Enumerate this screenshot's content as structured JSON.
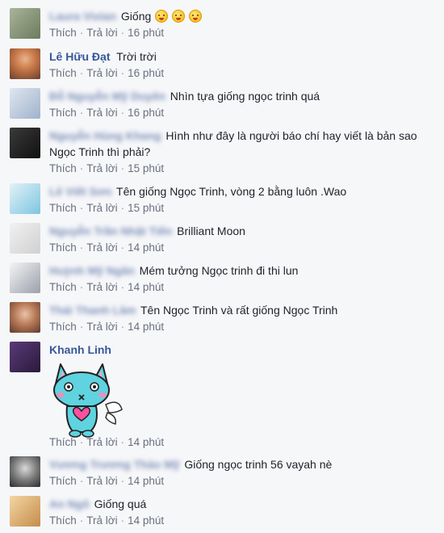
{
  "actions": {
    "like": "Thích",
    "reply": "Trả lời",
    "dot": "·"
  },
  "comments": [
    {
      "name": "Laura Vivian",
      "text": "Giống",
      "time": "16 phút"
    },
    {
      "name": "Lê Hữu Đạt",
      "text": "Trời trời",
      "time": "16 phút"
    },
    {
      "name": "Đỗ Nguyễn Mỹ Duyên",
      "text": "Nhìn tựa giống ngọc trinh quá",
      "time": "16 phút"
    },
    {
      "name": "Nguyễn Hùng Khang",
      "text": "Hình như đây là người báo chí hay viết là bản sao Ngọc Trinh thì phải?",
      "time": "15 phút"
    },
    {
      "name": "Lê Viết Sơn",
      "text": "Tên giống Ngọc Trinh, vòng 2 bằng luôn .Wao",
      "time": "15 phút"
    },
    {
      "name": "Nguyễn Trần Nhật Tiến",
      "text": "Brilliant Moon",
      "time": "14 phút"
    },
    {
      "name": "Huỳnh Mỹ Ngân",
      "text": "Mém tưởng Ngọc trinh đi thi lun",
      "time": "14 phút"
    },
    {
      "name": "Thái Thanh Lâm",
      "text": "Tên Ngọc Trinh và rất giống Ngọc Trinh",
      "time": "14 phút"
    },
    {
      "name": "Khanh Linh",
      "text": "",
      "time": "14 phút"
    },
    {
      "name": "Vương Trương Thảo Mỹ",
      "text": "Giống ngọc trinh 56 vayah nè",
      "time": "14 phút"
    },
    {
      "name": "An Ngô",
      "text": "Giống quá",
      "time": "14 phút"
    }
  ]
}
